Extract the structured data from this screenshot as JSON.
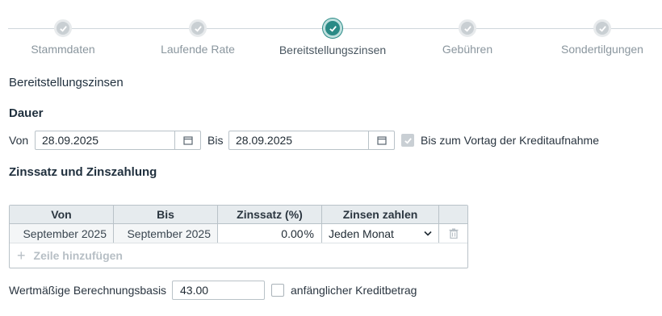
{
  "stepper": {
    "steps": [
      {
        "label": "Stammdaten",
        "state": "done"
      },
      {
        "label": "Laufende Rate",
        "state": "done"
      },
      {
        "label": "Bereitstellungszinsen",
        "state": "active"
      },
      {
        "label": "Gebühren",
        "state": "done"
      },
      {
        "label": "Sondertilgungen",
        "state": "done"
      }
    ]
  },
  "section_title": "Bereitstellungszinsen",
  "dauer": {
    "title": "Dauer",
    "von_label": "Von",
    "von_value": "28.09.2025",
    "bis_label": "Bis",
    "bis_value": "28.09.2025",
    "checkbox_label": "Bis zum Vortag der Kreditaufnahme",
    "checkbox_checked": true
  },
  "zins": {
    "title": "Zinssatz und Zinszahlung",
    "columns": [
      "Von",
      "Bis",
      "Zinssatz (%)",
      "Zinsen zahlen"
    ],
    "rows": [
      {
        "von": "September 2025",
        "bis": "September 2025",
        "zinssatz": "0.00",
        "unit": "%",
        "zahlen": "Jeden Monat"
      }
    ],
    "add_row_label": "Zeile hinzufügen"
  },
  "basis": {
    "label": "Wertmäßige Berechnungsbasis",
    "value": "43.00",
    "checkbox_label": "anfänglicher Kreditbetrag",
    "checkbox_checked": false
  },
  "colors": {
    "accent": "#2a8a86",
    "done": "#c9cfd3"
  }
}
